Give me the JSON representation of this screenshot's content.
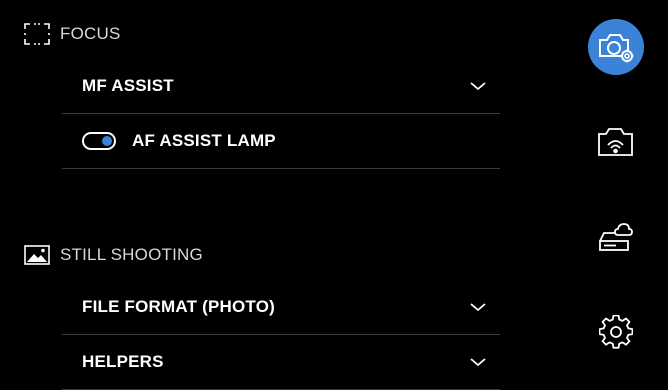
{
  "sections": {
    "focus": {
      "title": "FOCUS",
      "icon": "focus-bracket-icon",
      "items": [
        {
          "label": "MF ASSIST",
          "type": "dropdown"
        },
        {
          "label": "AF ASSIST LAMP",
          "type": "toggle",
          "enabled": true
        }
      ]
    },
    "still_shooting": {
      "title": "STILL SHOOTING",
      "icon": "image-icon",
      "items": [
        {
          "label": "FILE FORMAT (PHOTO)",
          "type": "dropdown"
        },
        {
          "label": "HELPERS",
          "type": "dropdown"
        }
      ]
    }
  },
  "side_nav": [
    {
      "icon": "camera-settings-icon",
      "active": true
    },
    {
      "icon": "camera-wireless-icon",
      "active": false
    },
    {
      "icon": "cloud-storage-icon",
      "active": false
    },
    {
      "icon": "gear-icon",
      "active": false
    }
  ],
  "colors": {
    "background": "#000000",
    "accent": "#3a83d8",
    "divider": "#3a3a3a",
    "text": "#ffffff"
  }
}
